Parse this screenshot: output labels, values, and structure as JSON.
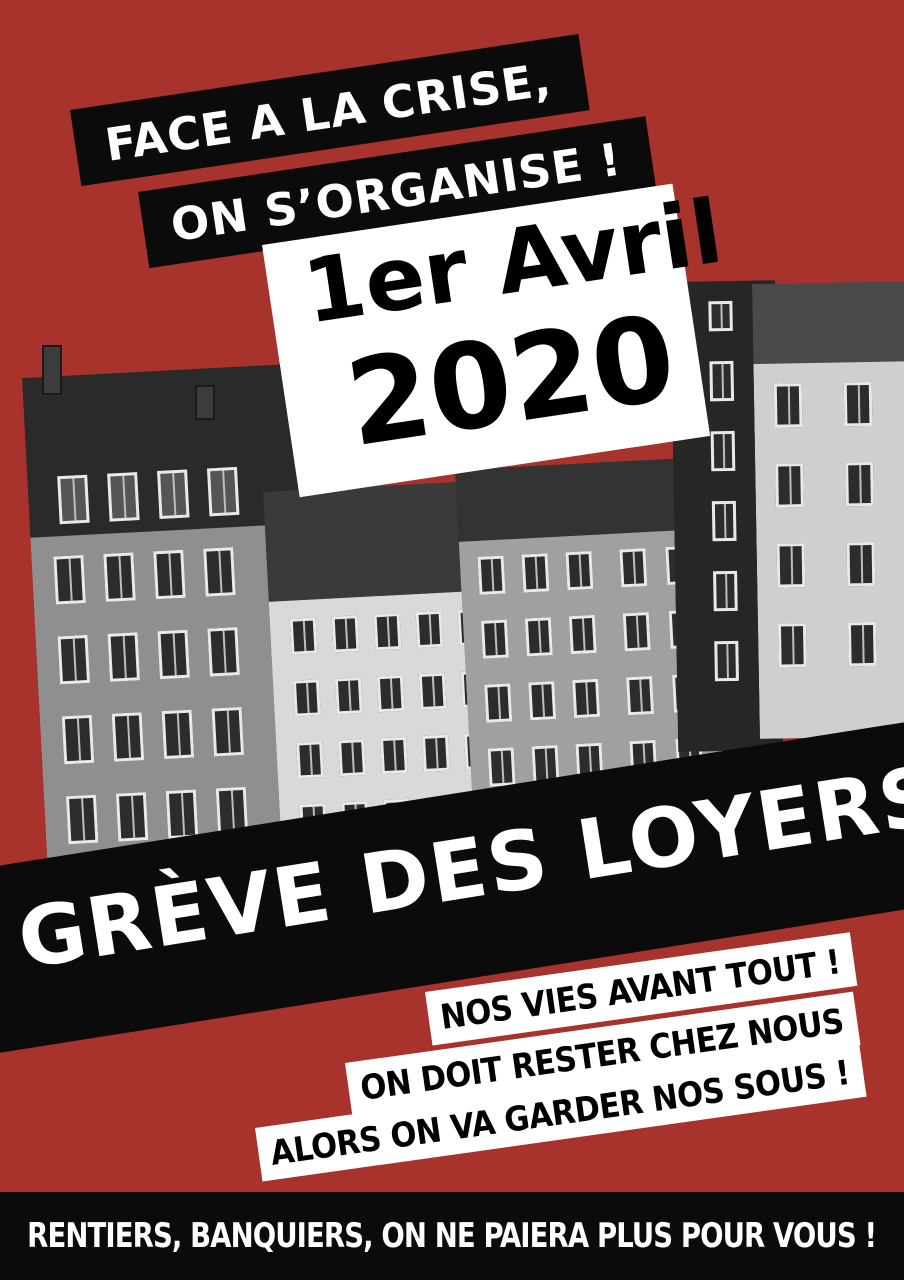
{
  "headline": {
    "line1": "FACE A LA CRISE,",
    "line2": "ON S’ORGANISE !"
  },
  "date": {
    "line1": "1er Avril",
    "line2": "2020"
  },
  "strike": {
    "title": "GRÈVE DES LOYERS"
  },
  "slogans": [
    "NOS VIES AVANT TOUT !",
    "ON DOIT RESTER CHEZ NOUS",
    "ALORS ON VA GARDER NOS SOUS !"
  ],
  "footer": {
    "text": "RENTIERS, BANQUIERS, ON NE PAIERA PLUS POUR VOUS !"
  },
  "colors": {
    "background": "#a8332d",
    "band": "#0b0b0b",
    "card": "#ffffff"
  }
}
